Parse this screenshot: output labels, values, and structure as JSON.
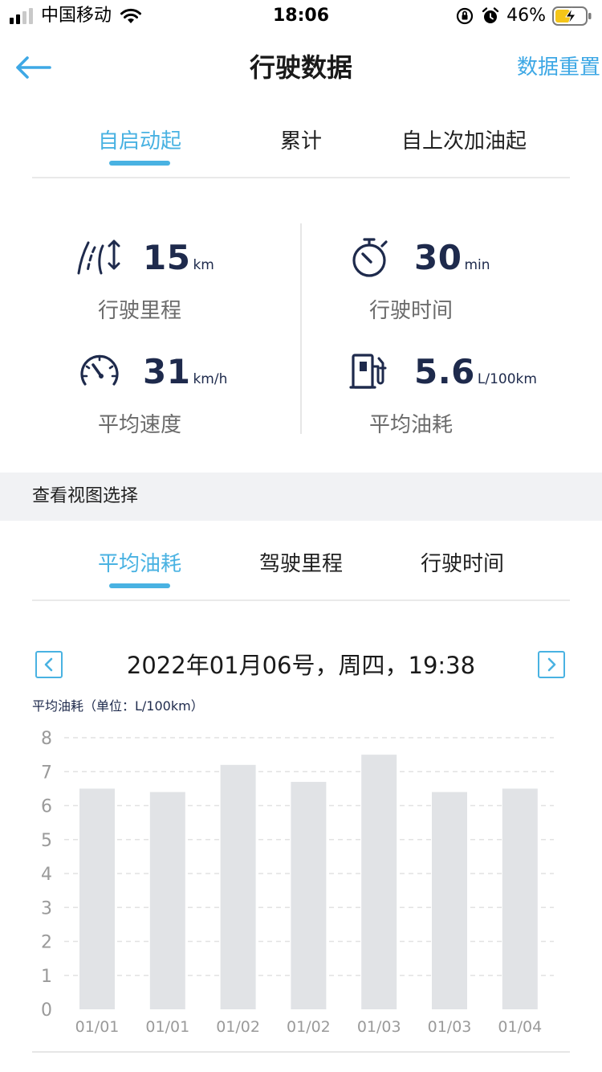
{
  "status_bar": {
    "carrier": "中国移动",
    "time": "18:06",
    "battery_percent": "46%"
  },
  "nav": {
    "title": "行驶数据",
    "reset_label": "数据重置"
  },
  "top_tabs": [
    {
      "label": "自启动起",
      "active": true
    },
    {
      "label": "累计",
      "active": false
    },
    {
      "label": "自上次加油起",
      "active": false
    }
  ],
  "stats": {
    "distance": {
      "value": "15",
      "unit": "km",
      "label": "行驶里程",
      "icon": "road-distance-icon"
    },
    "duration": {
      "value": "30",
      "unit": "min",
      "label": "行驶时间",
      "icon": "stopwatch-icon"
    },
    "avg_speed": {
      "value": "31",
      "unit": "km/h",
      "label": "平均速度",
      "icon": "speedometer-icon"
    },
    "avg_fuel": {
      "value": "5.6",
      "unit": "L/100km",
      "label": "平均油耗",
      "icon": "fuel-pump-icon"
    }
  },
  "view_section": {
    "label": "查看视图选择"
  },
  "view_tabs": [
    {
      "label": "平均油耗",
      "active": true
    },
    {
      "label": "驾驶里程",
      "active": false
    },
    {
      "label": "行驶时间",
      "active": false
    }
  ],
  "date_nav": {
    "text": "2022年01月06号，周四，19:38"
  },
  "chart_unit_label": "平均油耗（单位：L/100km）",
  "colors": {
    "accent": "#49b2e2",
    "link": "#3ea8e5",
    "bar": "#e1e3e6",
    "icon": "#1e2a4c"
  },
  "chart_data": {
    "type": "bar",
    "categories": [
      "01/01",
      "01/01",
      "01/02",
      "01/02",
      "01/03",
      "01/03",
      "01/04"
    ],
    "values": [
      6.5,
      6.4,
      7.2,
      6.7,
      7.5,
      6.4,
      6.5
    ],
    "ylim": [
      0,
      8
    ],
    "yticks": [
      0,
      1,
      2,
      3,
      4,
      5,
      6,
      7,
      8
    ],
    "grid": true
  }
}
